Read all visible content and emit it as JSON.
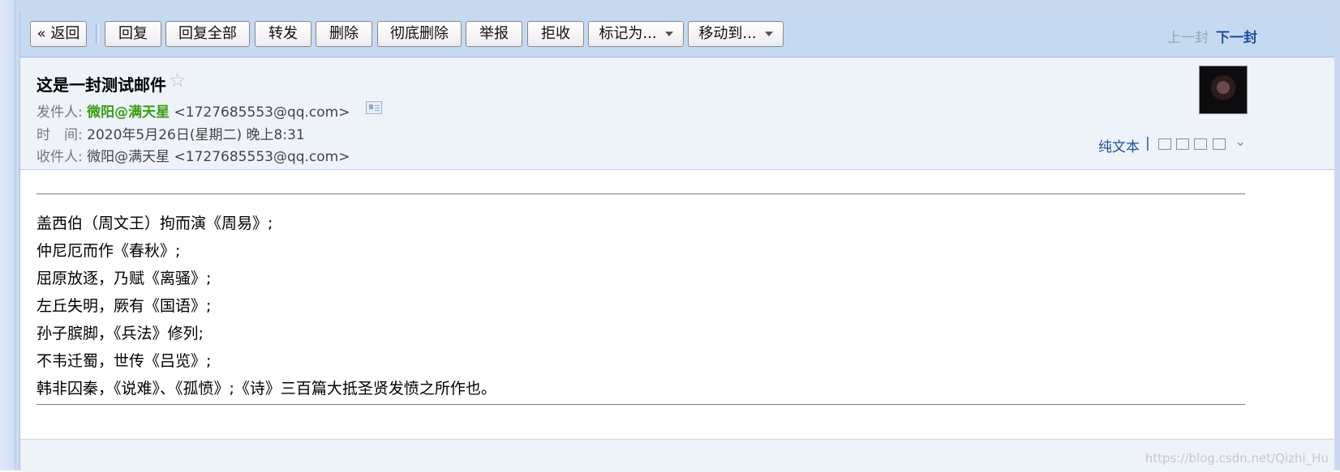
{
  "toolbar": {
    "back": "« 返回",
    "reply": "回复",
    "reply_all": "回复全部",
    "forward": "转发",
    "delete": "删除",
    "delete_permanently": "彻底删除",
    "report": "举报",
    "reject": "拒收",
    "mark_as": "标记为...",
    "move_to": "移动到...",
    "prev_mail": "上一封",
    "next_mail": "下一封"
  },
  "mail": {
    "subject": "这是一封测试邮件",
    "star": "☆",
    "from_label": "发件人:",
    "from_name": "微阳@满天星",
    "from_addr": "<1727685553@qq.com>",
    "time_label": "时　间:",
    "time_value": "2020年5月26日(星期二) 晚上8:31",
    "to_label": "收件人:",
    "to_name": "微阳@满天星",
    "to_addr": "<1727685553@qq.com>",
    "plain_text": "纯文本",
    "separator": "|"
  },
  "body": {
    "lines": [
      "盖西伯（周文王）拘而演《周易》;",
      "仲尼厄而作《春秋》;",
      "屈原放逐，乃赋《离骚》;",
      "左丘失明，厥有《国语》;",
      "孙子膑脚，《兵法》修列;",
      "不韦迁蜀，世传《吕览》;",
      "韩非囚秦，《说难》、《孤愤》;《诗》三百篇大抵圣贤发愤之所作也。"
    ]
  },
  "watermark": "https://blog.csdn.net/Qizhi_Hu",
  "icons": [
    "card-icon",
    "star-icon",
    "avatar",
    "new-window-icon",
    "note-icon",
    "download-icon",
    "print-icon",
    "expand-icon"
  ]
}
